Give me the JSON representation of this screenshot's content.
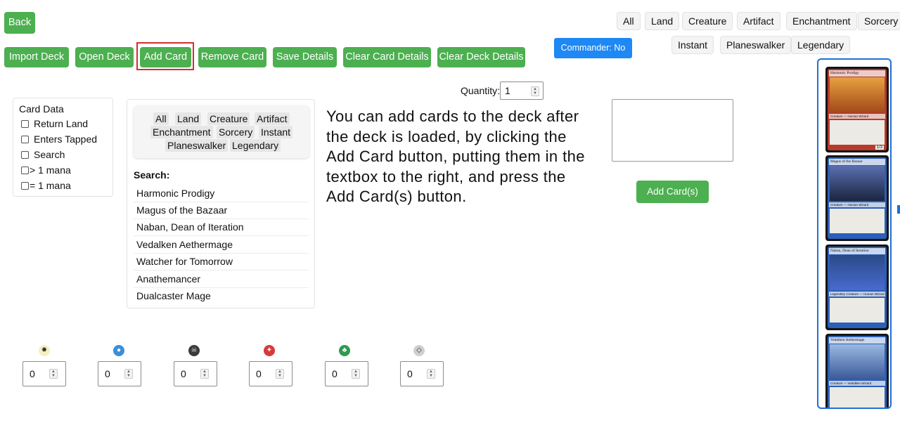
{
  "toolbar": {
    "back": "Back",
    "import_deck": "Import Deck",
    "open_deck": "Open Deck",
    "add_card": "Add Card",
    "remove_card": "Remove Card",
    "save_details": "Save Details",
    "clear_card_details": "Clear Card Details",
    "clear_deck_details": "Clear Deck Details"
  },
  "commander_toggle": "Commander: No",
  "type_filters": [
    "All",
    "Land",
    "Creature",
    "Artifact",
    "Enchantment",
    "Sorcery",
    "Instant",
    "Planeswalker",
    "Legendary"
  ],
  "quantity": {
    "label": "Quantity:",
    "value": "1"
  },
  "card_data": {
    "title": "Card Data",
    "options": [
      "Return Land",
      "Enters Tapped",
      "Search",
      "> 1 mana",
      "= 1 mana"
    ]
  },
  "search_panel": {
    "filters": [
      "All",
      "Land",
      "Creature",
      "Artifact",
      "Enchantment",
      "Sorcery",
      "Instant",
      "Planeswalker",
      "Legendary"
    ],
    "label": "Search:",
    "results": [
      "Harmonic Prodigy",
      "Magus of the Bazaar",
      "Naban, Dean of Iteration",
      "Vedalken Aethermage",
      "Watcher for Tomorrow",
      "Anathemancer",
      "Dualcaster Mage"
    ]
  },
  "tooltip_text": "You can add cards to the deck after the deck is loaded, by clicking the Add Card button, putting them in the textbox to the right, and press the Add Card(s) button.",
  "add_cards_button": "Add Card(s)",
  "card_images": [
    {
      "name": "Harmonic Prodigy",
      "type": "Creature — Human Wizard",
      "pt": "1/3",
      "color": "#c0392b"
    },
    {
      "name": "Magus of the Bazaar",
      "type": "Creature — Human Wizard",
      "pt": "",
      "color": "#2f6fd0"
    },
    {
      "name": "Naban, Dean of Iteration",
      "type": "Legendary Creature — Human Wizard",
      "pt": "",
      "color": "#2f6fd0"
    },
    {
      "name": "Vedalken Aethermage",
      "type": "Creature — Vedalken Wizard",
      "pt": "",
      "color": "#2f6fd0"
    }
  ],
  "mana": [
    {
      "symbol": "white",
      "value": "0",
      "color": "#f5f0c0"
    },
    {
      "symbol": "blue",
      "value": "0",
      "color": "#3a8fd8"
    },
    {
      "symbol": "black",
      "value": "0",
      "color": "#3a3a3a"
    },
    {
      "symbol": "red",
      "value": "0",
      "color": "#d63b3b"
    },
    {
      "symbol": "green",
      "value": "0",
      "color": "#2e9a52"
    },
    {
      "symbol": "colorless",
      "value": "0",
      "color": "#cfcfcf"
    }
  ],
  "colors": {
    "green_button": "#4caf50",
    "commander_blue": "#1e88f5",
    "highlight_red": "#d32f2f"
  }
}
